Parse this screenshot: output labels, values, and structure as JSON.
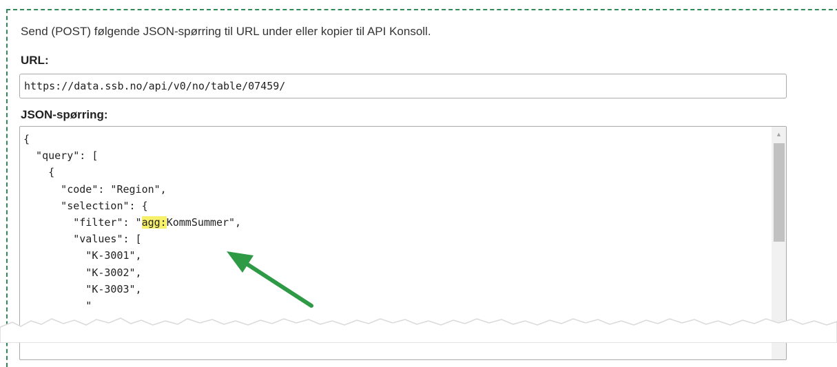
{
  "intro_text": "Send (POST) følgende JSON-spørring til URL under eller kopier til API Konsoll.",
  "url_label": "URL:",
  "url_value": "https://data.ssb.no/api/v0/no/table/07459/",
  "json_label": "JSON-spørring:",
  "code_lines": {
    "l1": "{",
    "l2": "  \"query\": [",
    "l3": "    {",
    "l4": "      \"code\": \"Region\",",
    "l5": "      \"selection\": {",
    "l6_pre": "        \"filter\": \"",
    "l6_hl": "agg:",
    "l6_post": "KommSummer\",",
    "l7": "        \"values\": [",
    "l8": "          \"K-3001\",",
    "l9": "          \"K-3002\",",
    "l10": "          \"K-3003\",",
    "l11": "          \""
  },
  "annotation": {
    "arrow_color": "#2e9a46",
    "highlight_color": "#f6f06a"
  },
  "frame_color": "#2e8b57"
}
